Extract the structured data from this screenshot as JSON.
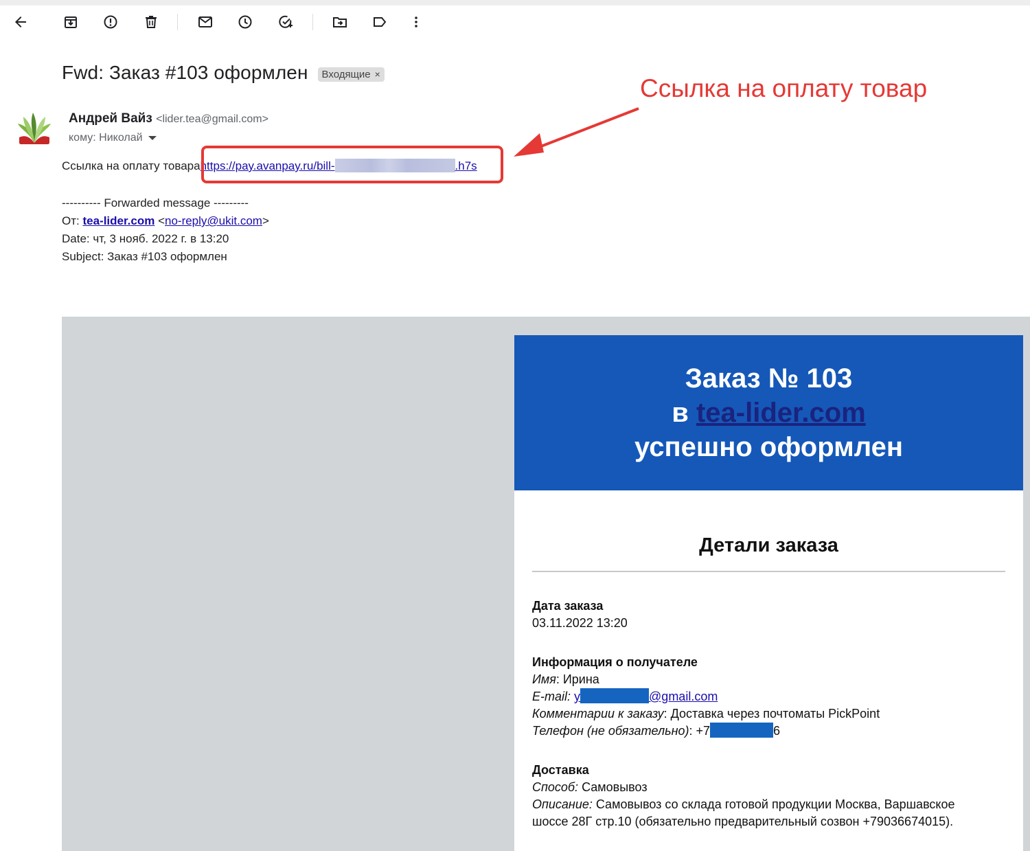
{
  "toolbar": {
    "icons": [
      "back-icon",
      "archive-icon",
      "spam-icon",
      "delete-icon",
      "mark-unread-icon",
      "snooze-icon",
      "add-task-icon",
      "move-to-icon",
      "label-icon",
      "more-vert-icon"
    ]
  },
  "message": {
    "subject": "Fwd: Заказ #103 оформлен",
    "label": "Входящие",
    "label_close": "×",
    "sender_name": "Андрей Вайз",
    "sender_email": "<lider.tea@gmail.com>",
    "recipient": "кому: Николай",
    "pay_text": "Ссылка на оплату товара",
    "pay_link_start": "https://pay.avanpay.ru/bill-",
    "pay_link_end": ".h7s"
  },
  "annotation": {
    "text": "Ссылка на оплату товар",
    "color": "#e53935"
  },
  "forwarded": {
    "separator": "---------- Forwarded message ---------",
    "from_label": "От:",
    "from_name": "tea-lider.com",
    "from_email": "no-reply@ukit.com",
    "date": "Date: чт, 3 нояб. 2022 г. в 13:20",
    "subject": "Subject: Заказ #103 оформлен"
  },
  "order_card": {
    "header_line1": "Заказ № 103",
    "header_line2_prefix": "в",
    "header_link": "tea-lider.com",
    "header_line3": "успешно оформлен",
    "header_color": "#1558b8",
    "details_title": "Детали заказа",
    "order_date_title": "Дата заказа",
    "order_date": "03.11.2022 13:20",
    "recipient_title": "Информация о получателе",
    "name_label": "Имя",
    "name_value": ": Ирина",
    "email_label": "E-mail:",
    "email_prefix": "y",
    "email_suffix": "@gmail.com",
    "comment_label": "Комментарии к заказу",
    "comment_value": ": Доставка через почтоматы PickPoint",
    "phone_label": "Телефон (не обязательно)",
    "phone_prefix": ": +7",
    "phone_suffix": "6",
    "delivery_title": "Доставка",
    "method_label": "Способ:",
    "method_value": " Самовывоз",
    "desc_label": "Описание:",
    "desc_value_1": " Самовывоз со склада готовой продукции Москва, Варшавское",
    "desc_value_2": "шоссе 28Г стр.10 (обязательно предварительный созвон +79036674015)."
  }
}
